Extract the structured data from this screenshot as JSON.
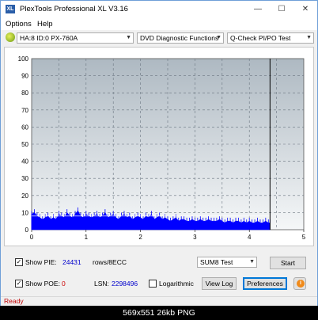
{
  "window": {
    "title": "PlexTools Professional XL V3.16",
    "icon_label": "XL",
    "minimize_glyph": "—",
    "maximize_glyph": "☐",
    "close_glyph": "✕"
  },
  "menu": [
    "Options",
    "Help"
  ],
  "toolbar": {
    "drive": "HA:8 ID:0  PX-760A",
    "function": "DVD Diagnostic Functions",
    "test": "Q-Check PI/PO Test",
    "arrow": "▼"
  },
  "chart_data": {
    "type": "area",
    "x_ticks": [
      "0",
      "1",
      "2",
      "3",
      "4",
      "5"
    ],
    "y_ticks": [
      "100",
      "90",
      "80",
      "70",
      "60",
      "50",
      "40",
      "30",
      "20",
      "10",
      "0"
    ],
    "xlim": [
      0,
      5
    ],
    "ylim": [
      0,
      100
    ],
    "grid": true,
    "end_marker_x": 4.38,
    "reference_line_y": 8,
    "series": [
      {
        "color": "#0000ff",
        "x": [
          0.0,
          0.05,
          0.1,
          0.15,
          0.2,
          0.25,
          0.3,
          0.35,
          0.4,
          0.45,
          0.5,
          0.55,
          0.6,
          0.65,
          0.7,
          0.75,
          0.8,
          0.85,
          0.9,
          0.95,
          1.0,
          1.05,
          1.1,
          1.15,
          1.2,
          1.25,
          1.3,
          1.35,
          1.4,
          1.45,
          1.5,
          1.55,
          1.6,
          1.65,
          1.7,
          1.75,
          1.8,
          1.85,
          1.9,
          1.95,
          2.0,
          2.05,
          2.1,
          2.15,
          2.2,
          2.25,
          2.3,
          2.35,
          2.4,
          2.45,
          2.5,
          2.55,
          2.6,
          2.65,
          2.7,
          2.75,
          2.8,
          2.85,
          2.9,
          2.95,
          3.0,
          3.05,
          3.1,
          3.15,
          3.2,
          3.25,
          3.3,
          3.35,
          3.4,
          3.45,
          3.5,
          3.55,
          3.6,
          3.65,
          3.7,
          3.75,
          3.8,
          3.85,
          3.9,
          3.95,
          4.0,
          4.05,
          4.1,
          4.15,
          4.2,
          4.25,
          4.3,
          4.35,
          4.38
        ],
        "y": [
          9,
          10,
          8,
          7,
          6,
          7,
          8,
          6,
          7,
          6,
          9,
          8,
          7,
          10,
          8,
          7,
          9,
          11,
          8,
          7,
          9,
          8,
          7,
          8,
          9,
          7,
          8,
          10,
          7,
          8,
          9,
          7,
          6,
          8,
          9,
          7,
          8,
          6,
          7,
          8,
          7,
          6,
          8,
          7,
          9,
          6,
          7,
          8,
          6,
          7,
          6,
          5,
          6,
          7,
          5,
          6,
          6,
          5,
          5,
          6,
          5,
          5,
          6,
          5,
          5,
          6,
          5,
          5,
          5,
          6,
          5,
          4,
          5,
          5,
          4,
          5,
          5,
          4,
          5,
          4,
          5,
          4,
          4,
          5,
          4,
          4,
          5,
          4,
          4
        ]
      }
    ]
  },
  "controls": {
    "pie_label": "Show PIE:",
    "pie_value": "24431",
    "pie_unit": "rows/8ECC",
    "poe_label": "Show POE:",
    "poe_value": "0",
    "lsn_label": "LSN:",
    "lsn_value": "2298496",
    "log_label": "Logarithmic",
    "sum_test": "SUM8 Test",
    "start": "Start",
    "view_log": "View Log",
    "preferences": "Preferences",
    "info_glyph": "i",
    "check_glyph": "✓"
  },
  "status": "Ready",
  "caption": "569x551  26kb  PNG"
}
